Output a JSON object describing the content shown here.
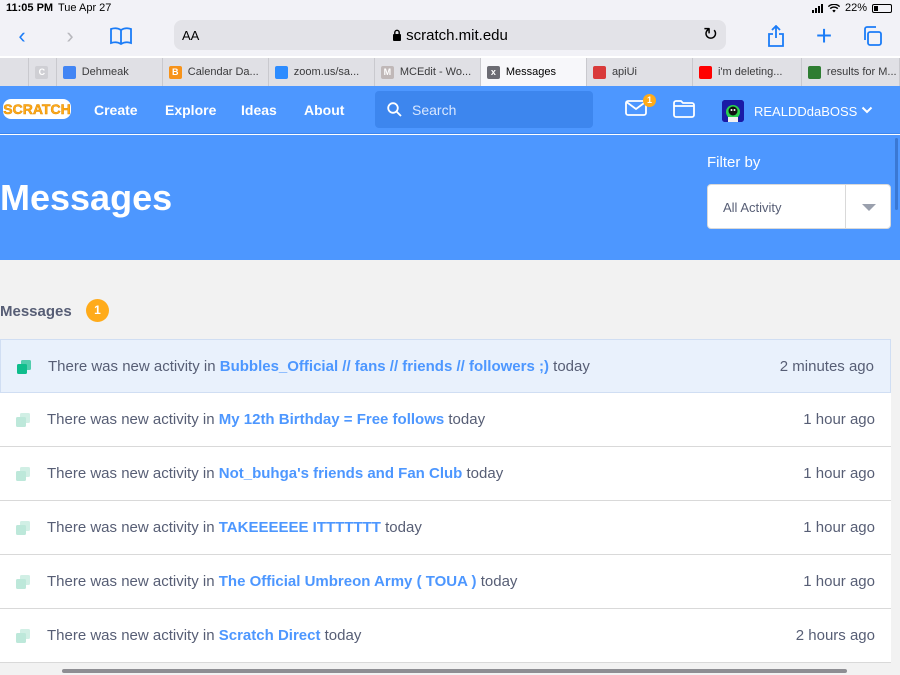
{
  "status_bar": {
    "time": "11:05 PM",
    "date": "Tue Apr 27",
    "battery": "22%",
    "battery_level": 0.22
  },
  "browser": {
    "aa_label": "AA",
    "url": "scratch.mit.edu",
    "tabs": [
      {
        "label": "",
        "favicon": "C",
        "favicon_color": "#cfcfd4"
      },
      {
        "label": "Dehmeak",
        "favicon": "",
        "favicon_color": "#4285f4"
      },
      {
        "label": "Calendar Da...",
        "favicon": "B",
        "favicon_color": "#f7931a"
      },
      {
        "label": "zoom.us/sa...",
        "favicon": "",
        "favicon_color": "#2d8cff"
      },
      {
        "label": "MCEdit - Wo...",
        "favicon": "M",
        "favicon_color": "#c0b8b8"
      },
      {
        "label": "Messages",
        "favicon": "x",
        "favicon_color": "#6b6b73",
        "active": true
      },
      {
        "label": "apiUi",
        "favicon": "",
        "favicon_color": "#d93a3a"
      },
      {
        "label": "i'm deleting...",
        "favicon": "",
        "favicon_color": "#ff0000"
      },
      {
        "label": "results for M...",
        "favicon": "",
        "favicon_color": "#2e7d32"
      }
    ]
  },
  "nav": {
    "logo": "SCRATCH",
    "links": [
      "Create",
      "Explore",
      "Ideas",
      "About"
    ],
    "search_placeholder": "Search",
    "message_count": "1",
    "username": "REALDDdaBOSS"
  },
  "header": {
    "title": "Messages",
    "filter_label": "Filter by",
    "filter_value": "All Activity"
  },
  "messages_section": {
    "title": "Messages",
    "count": "1",
    "items": [
      {
        "prefix": "There was new activity in",
        "studio": "Bubbles_Official // fans // friends // followers ;)",
        "suffix": "today",
        "time": "2 minutes ago",
        "unread": true
      },
      {
        "prefix": "There was new activity in",
        "studio": "My 12th Birthday = Free follows",
        "suffix": "today",
        "time": "1 hour ago",
        "unread": false
      },
      {
        "prefix": "There was new activity in",
        "studio": "Not_buhga's friends and Fan Club",
        "suffix": "today",
        "time": "1 hour ago",
        "unread": false
      },
      {
        "prefix": "There was new activity in",
        "studio": "TAKEEEEEE ITTTTTTT",
        "suffix": "today",
        "time": "1 hour ago",
        "unread": false
      },
      {
        "prefix": "There was new activity in",
        "studio": "The Official Umbreon Army ( TOUA )",
        "suffix": "today",
        "time": "1 hour ago",
        "unread": false
      },
      {
        "prefix": "There was new activity in",
        "studio": "Scratch Direct",
        "suffix": "today",
        "time": "2 hours ago",
        "unread": false
      }
    ]
  },
  "colors": {
    "scratch_blue": "#4d97ff",
    "link_blue": "#4d97ff",
    "badge_orange": "#ffab1a",
    "unread_icon": "#0fbd8c",
    "read_icon": "#bde8da"
  }
}
